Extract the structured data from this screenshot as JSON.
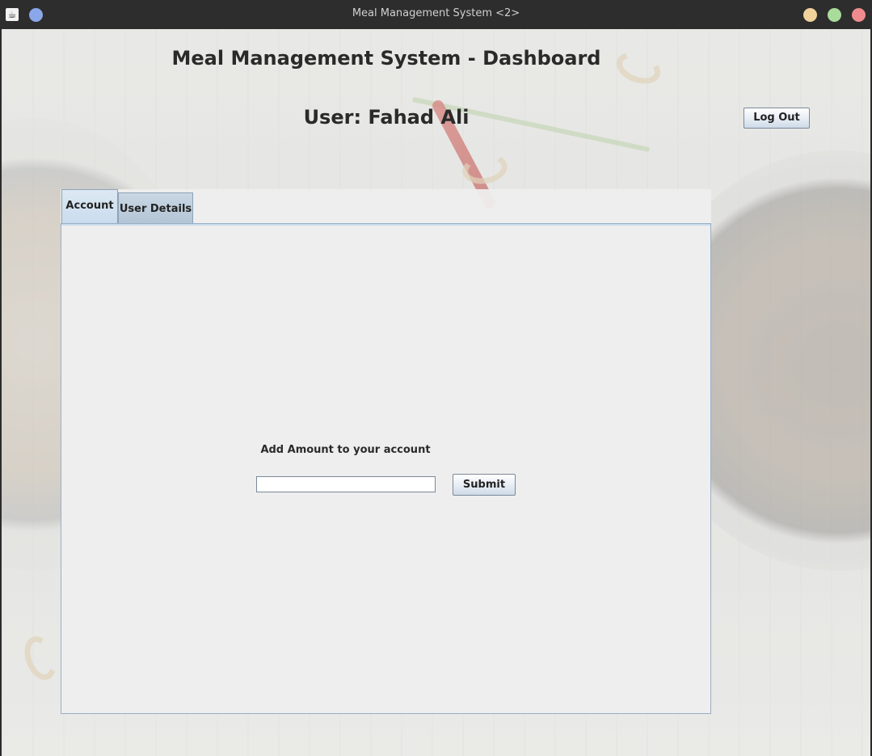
{
  "window": {
    "title": "Meal Management System <2>",
    "controls": [
      "minimize-button",
      "maximize-button",
      "close-button"
    ],
    "colors": {
      "minimize": "#f0d29a",
      "maximize": "#a9dc9a",
      "close": "#ef8b8e",
      "menu_dot": "#8aa7ea"
    }
  },
  "header": {
    "title": "Meal Management System - Dashboard",
    "user": "User: Fahad Ali",
    "logout_label": "Log Out"
  },
  "tabs": [
    {
      "label": "Account",
      "selected": true
    },
    {
      "label": "User Details",
      "selected": false
    }
  ],
  "account": {
    "prompt": "Add Amount to your account",
    "amount_value": "",
    "submit_label": "Submit"
  }
}
